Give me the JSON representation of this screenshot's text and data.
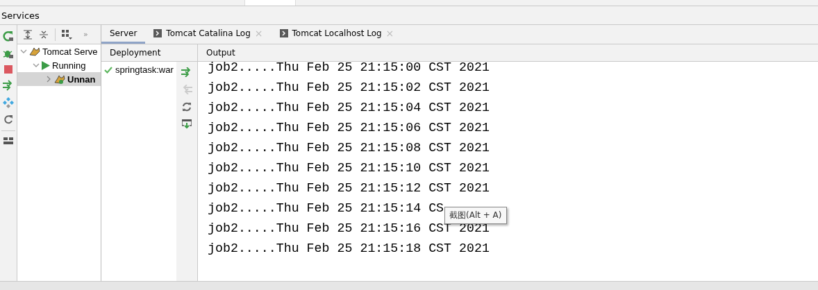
{
  "window": {
    "title": "Services"
  },
  "tree": [
    {
      "label": "Tomcat Serve",
      "kind": "server",
      "expanded": true,
      "selected": false,
      "children": [
        {
          "label": "Running",
          "kind": "status",
          "expanded": true,
          "selected": false,
          "children": [
            {
              "label": "Unnan",
              "kind": "app",
              "expanded": false,
              "selected": true
            }
          ]
        }
      ]
    }
  ],
  "tree_toolbar": {
    "overflow": "»"
  },
  "tabs": [
    {
      "label": "Server",
      "selected": true,
      "closable": false
    },
    {
      "label": "Tomcat Catalina Log",
      "selected": false,
      "closable": true
    },
    {
      "label": "Tomcat Localhost Log",
      "selected": false,
      "closable": true
    }
  ],
  "tab_close": "×",
  "deployment": {
    "header": "Deployment",
    "items": [
      {
        "label": "springtask:war",
        "deployed": true
      }
    ]
  },
  "output": {
    "header": "Output",
    "lines": [
      "job2.....Thu Feb 25 21:15:00 CST 2021",
      "job2.....Thu Feb 25 21:15:02 CST 2021",
      "job2.....Thu Feb 25 21:15:04 CST 2021",
      "job2.....Thu Feb 25 21:15:06 CST 2021",
      "job2.....Thu Feb 25 21:15:08 CST 2021",
      "job2.....Thu Feb 25 21:15:10 CST 2021",
      "job2.....Thu Feb 25 21:15:12 CST 2021",
      "job2.....Thu Feb 25 21:15:14 CS",
      "job2.....Thu Feb 25 21:15:16 CST 2021",
      "job2.....Thu Feb 25 21:15:18 CST 2021"
    ]
  },
  "tooltip": "截图(Alt + A)"
}
